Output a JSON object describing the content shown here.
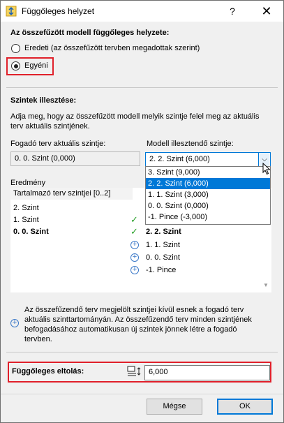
{
  "window": {
    "title": "Függőleges helyzet",
    "help": "?",
    "close": "✕"
  },
  "position": {
    "heading": "Az összefűzött modell függőleges helyzete:",
    "option_original": "Eredeti (az összefűzött tervben megadottak szerint)",
    "option_custom": "Egyéni",
    "selected": "custom"
  },
  "levels": {
    "heading": "Szintek illesztése:",
    "description_line1": "Adja meg, hogy az összefűzött modell melyik szintje felel meg az aktuális",
    "description_line2": "terv aktuális szintjének.",
    "host_label": "Fogadó terv aktuális szintje:",
    "host_value": "0. 0. Szint (0,000)",
    "model_label": "Modell illesztendő szintje:",
    "model_value": "2. 2. Szint (6,000)",
    "dropdown_options": [
      "3. Szint (9,000)",
      "2. 2. Szint (6,000)",
      "1. 1. Szint (3,000)",
      "0. 0. Szint (0,000)",
      "-1. Pince (-3,000)"
    ],
    "dropdown_selected_index": 1
  },
  "result": {
    "label": "Eredmény",
    "list_header": "Tartalmazó terv szintjei [0..2]",
    "host_rows": [
      "2. Szint",
      "1. Szint",
      "0. 0. Szint"
    ],
    "model_rows": [
      "2. 2. Szint",
      "1. 1. Szint",
      "0. 0. Szint",
      "-1. Pince"
    ]
  },
  "info": {
    "text1_line1": "Az összefűzendő terv megjelölt szintjei kívül esnek a fogadó terv",
    "text1_line2": "aktuális szinttartományán. Az összefűzendő terv minden szintjének",
    "text1_line3": "befogadásához automatikusan új szintek jönnek létre a fogadó",
    "text1_line4": "tervben."
  },
  "offset": {
    "label": "Függőleges eltolás:",
    "value": "6,000"
  },
  "buttons": {
    "cancel": "Mégse",
    "ok": "OK"
  },
  "colors": {
    "accent": "#0078d7",
    "highlight_border": "#e0202a",
    "check": "#2aa12a",
    "plus": "#3a78c8"
  }
}
